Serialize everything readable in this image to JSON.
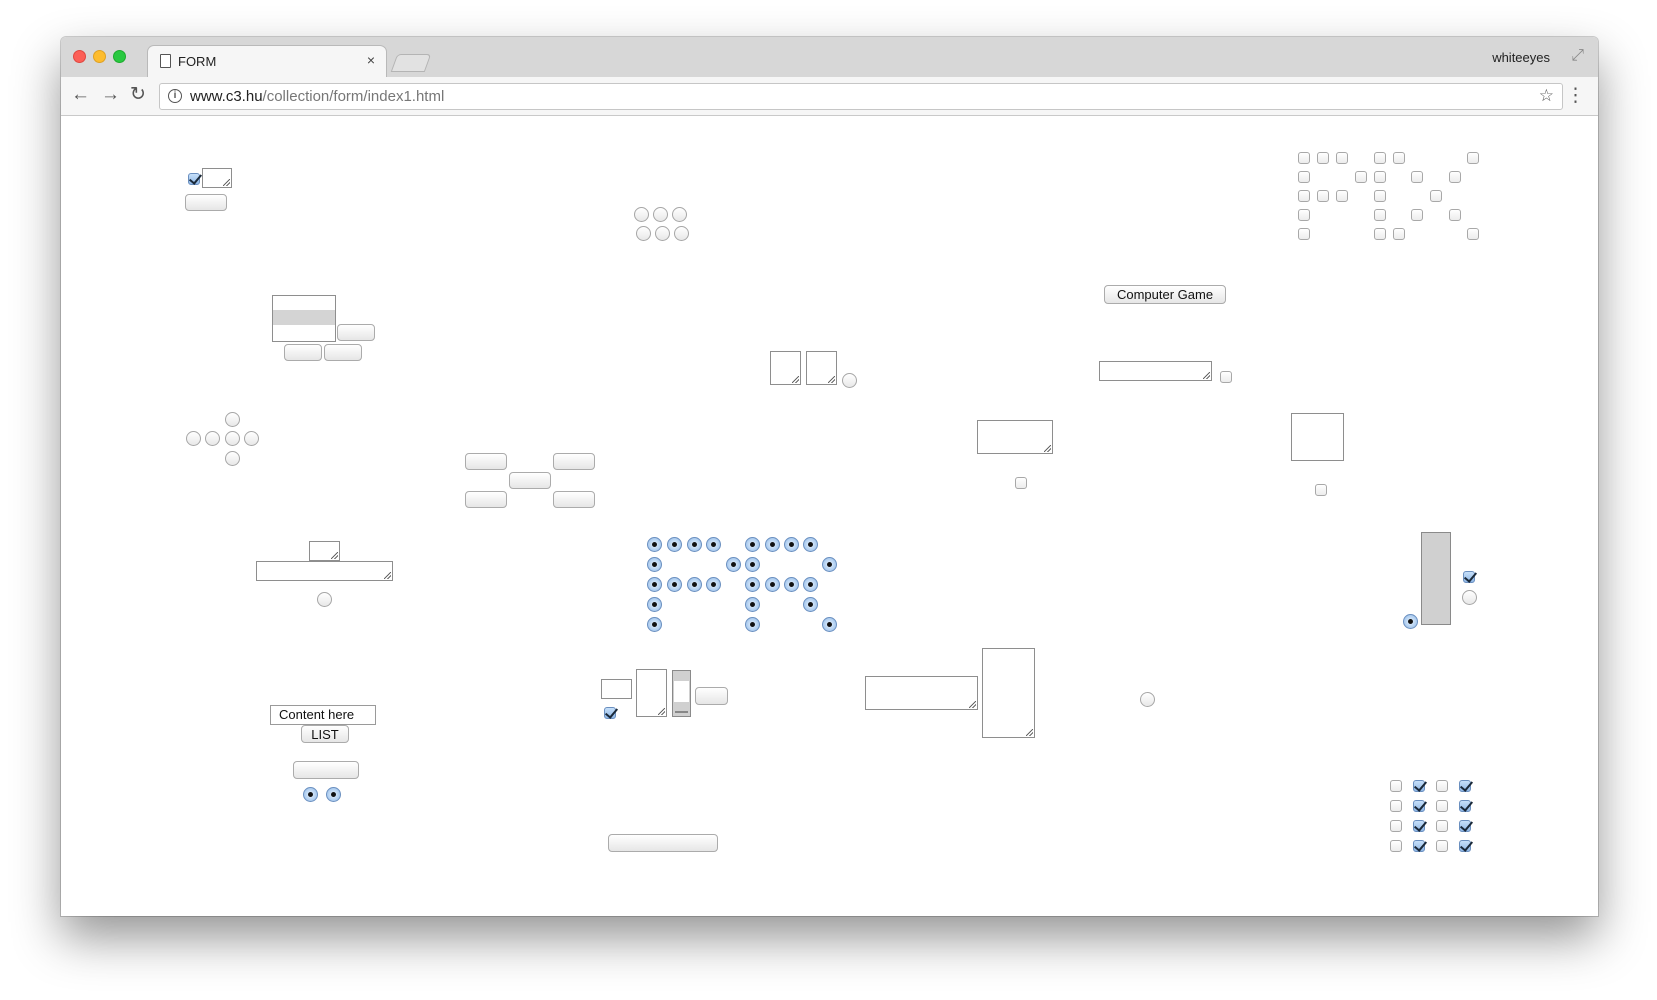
{
  "browser": {
    "tab_title": "FORM",
    "tab_close": "×",
    "profile_name": "whiteeyes",
    "url_host": "www.c3.hu",
    "url_path": "/collection/form/index1.html",
    "icons": [
      "back-arrow-icon",
      "forward-arrow-icon",
      "reload-icon",
      "info-icon",
      "star-icon",
      "menu-dots-icon",
      "page-icon",
      "resize-icon"
    ]
  },
  "buttons": {
    "computer_game": "Computer Game",
    "list": "LIST"
  },
  "fields": {
    "content": "Content here"
  },
  "colors": {
    "accent_blue": "#8fb7e6",
    "titlebar": "#d7d7d7",
    "toolbar": "#f6f6f6",
    "traffic_red": "#fc5f57",
    "traffic_yellow": "#fdbc2e",
    "traffic_green": "#29c840"
  }
}
